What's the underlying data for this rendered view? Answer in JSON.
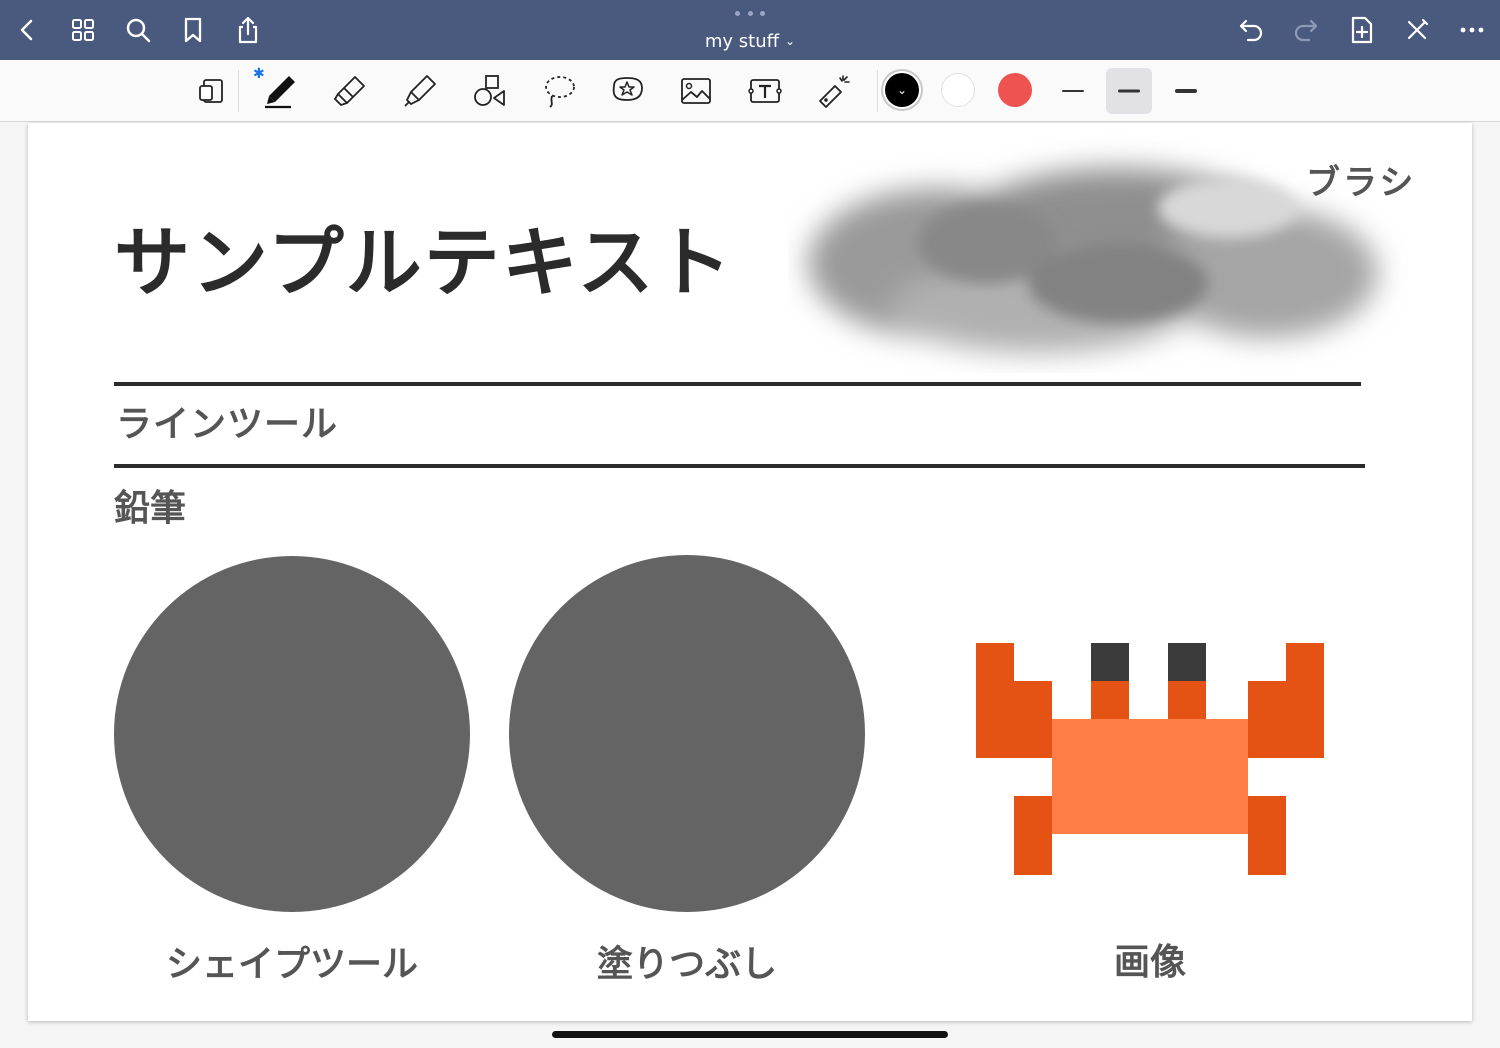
{
  "nav": {
    "title": "my stuff",
    "title_chevron": "⌄"
  },
  "toolbar": {
    "tools": [
      "page-layout",
      "pen",
      "eraser",
      "highlighter",
      "shapes",
      "lasso",
      "sticker",
      "image",
      "text-box",
      "laser-pointer"
    ],
    "bluetooth_badge": "✱",
    "colors": [
      "#000000",
      "#ffffff",
      "#ef5350"
    ],
    "selected_color_mark": "⌄"
  },
  "page": {
    "title": "サンプルテキスト",
    "brush_label": "ブラシ",
    "line_tool_label": "ラインツール",
    "pencil_label": "鉛筆",
    "captions": {
      "shape_tool": "シェイプツール",
      "fill": "塗りつぶし",
      "image": "画像"
    }
  },
  "colors": {
    "nav_bar": "#4a5a7e",
    "shape_fill": "#646464",
    "crab_dark_orange": "#e55314",
    "crab_light_orange": "#ff7e45",
    "crab_eyes": "#3b3b3b"
  }
}
